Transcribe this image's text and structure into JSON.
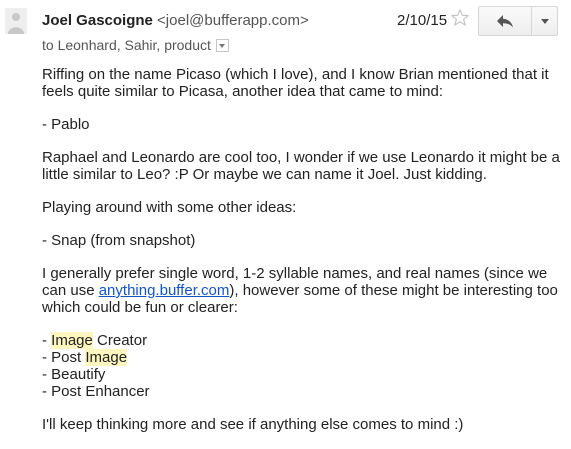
{
  "header": {
    "sender_name": "Joel Gascoigne",
    "sender_email": "<joel@bufferapp.com>",
    "recipients": "to Leonhard, Sahir, product",
    "date": "2/10/15",
    "icons": {
      "avatar": "avatar-placeholder-icon",
      "star": "star-icon",
      "reply": "reply-icon",
      "more": "chevron-down-icon",
      "recipients_dropdown": "chevron-down-icon"
    }
  },
  "body": {
    "p1": "Riffing on the name Picaso (which I love), and I know Brian mentioned that it feels quite similar to Picasa, another idea that came to mind:",
    "p2": "- Pablo",
    "p3": "Raphael and Leonardo are cool too, I wonder if we use Leonardo it might be a little similar to Leo? :P Or maybe we can name it Joel. Just kidding.",
    "p4": "Playing around with some other ideas:",
    "p5": "- Snap (from snapshot)",
    "p6_before": "I generally prefer single word, 1-2 syllable names, and real names (since we can use ",
    "p6_link": "anything.buffer.com",
    "p6_after": "), however some of these might be interesting too which could be fun or clearer:",
    "list": [
      {
        "prefix": "- ",
        "highlight": "Image",
        "suffix": " Creator"
      },
      {
        "prefix": "- Post ",
        "highlight": "Image",
        "suffix": ""
      },
      {
        "prefix": "- Beautify",
        "highlight": "",
        "suffix": ""
      },
      {
        "prefix": "- Post Enhancer",
        "highlight": "",
        "suffix": ""
      }
    ],
    "closing": "I'll keep thinking more and see if anything else comes to mind :)"
  },
  "colors": {
    "link": "#1155cc",
    "highlight": "#fff6bf",
    "text": "#222222",
    "muted": "#555555"
  }
}
